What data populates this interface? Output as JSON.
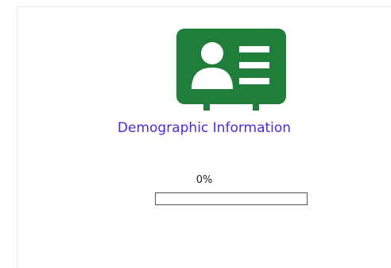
{
  "card": {
    "icon": "contact-card-icon",
    "icon_color": "#1e7e3a",
    "title": "Demographic Information",
    "title_color": "#4a2be3",
    "progress": {
      "label": "0%",
      "value": 0
    }
  }
}
